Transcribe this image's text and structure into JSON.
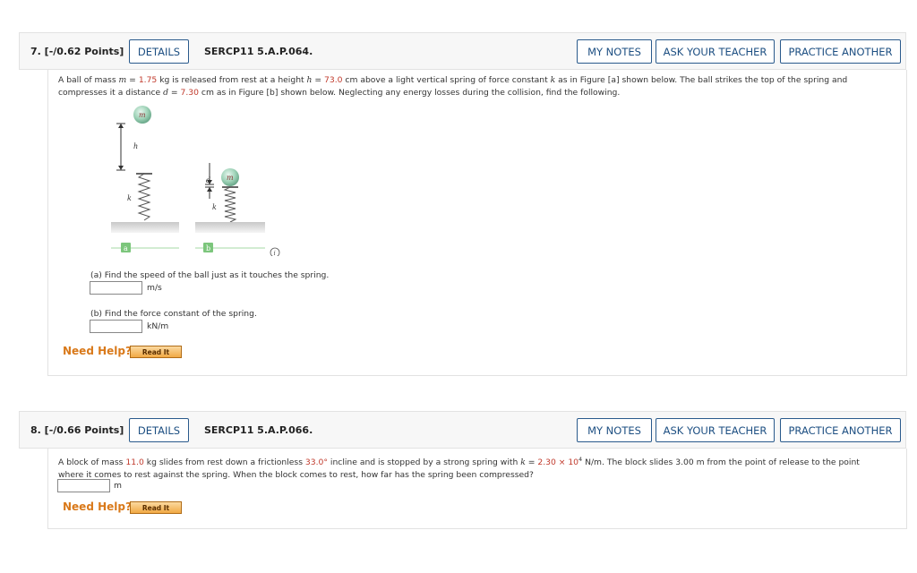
{
  "q7": {
    "number": "7. [-/0.62 Points]",
    "details": "DETAILS",
    "code": "SERCP11 5.A.P.064.",
    "my_notes": "MY NOTES",
    "ask_teacher": "ASK YOUR TEACHER",
    "practice": "PRACTICE ANOTHER",
    "problem": {
      "t1": "A ball of mass ",
      "m_var": "m",
      "t2": " = ",
      "m_val": "1.75",
      "t3": " kg is released from rest at a height ",
      "h_var": "h",
      "t4": " = ",
      "h_val": "73.0",
      "t5": " cm above a light vertical spring of force constant ",
      "k_var": "k",
      "t6": " as in Figure [a] shown below. The ball strikes the top of the spring and",
      "t7": "compresses it a distance ",
      "d_var": "d",
      "t8": " = ",
      "d_val": "7.30",
      "t9": " cm as in Figure [b] shown below. Neglecting any energy losses during the collision, find the following."
    },
    "figure": {
      "ball_label": "m",
      "h_label": "h",
      "k_label": "k",
      "d_label": "d",
      "panel_a": "a",
      "panel_b": "b",
      "info_icon": "i"
    },
    "part_a": {
      "text": "(a) Find the speed of the ball just as it touches the spring.",
      "value": "",
      "unit": "m/s"
    },
    "part_b": {
      "text": "(b) Find the force constant of the spring.",
      "value": "",
      "unit": "kN/m"
    },
    "need_help": "Need Help?",
    "read_it": "Read It"
  },
  "q8": {
    "number": "8. [-/0.66 Points]",
    "details": "DETAILS",
    "code": "SERCP11 5.A.P.066.",
    "my_notes": "MY NOTES",
    "ask_teacher": "ASK YOUR TEACHER",
    "practice": "PRACTICE ANOTHER",
    "problem": {
      "t1": "A block of mass ",
      "mass_val": "11.0",
      "t2": " kg slides from rest down a frictionless ",
      "angle_val": "33.0°",
      "t3": " incline and is stopped by a strong spring with ",
      "k_var": "k",
      "t4": " = ",
      "k_val": "2.30 × 10",
      "k_exp": "4",
      "t5": " N/m. The block slides 3.00 m from the point of release to the point",
      "t6": "where it comes to rest against the spring. When the block comes to rest, how far has the spring been compressed?"
    },
    "answer": {
      "value": "",
      "unit": "m"
    },
    "need_help": "Need Help?",
    "read_it": "Read It"
  }
}
